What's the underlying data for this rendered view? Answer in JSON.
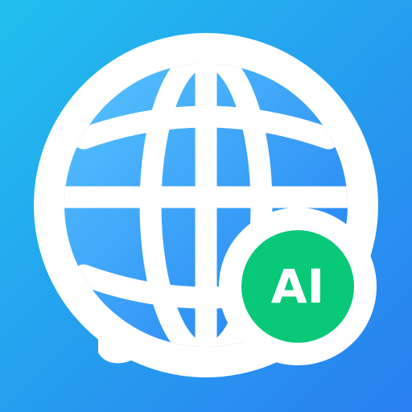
{
  "app_icon": {
    "name": "globe-chat-ai-icon",
    "icons": [
      "globe-icon",
      "speech-bubble-icon",
      "ai-badge-icon"
    ],
    "badge": {
      "label": "AI"
    },
    "colors": {
      "background_start": "#20bfee",
      "background_end": "#2a7ff0",
      "globe_fill_start": "#58c5ff",
      "globe_fill_end": "#1f7df2",
      "foreground": "#ffffff",
      "badge_fill": "#08c978"
    }
  }
}
